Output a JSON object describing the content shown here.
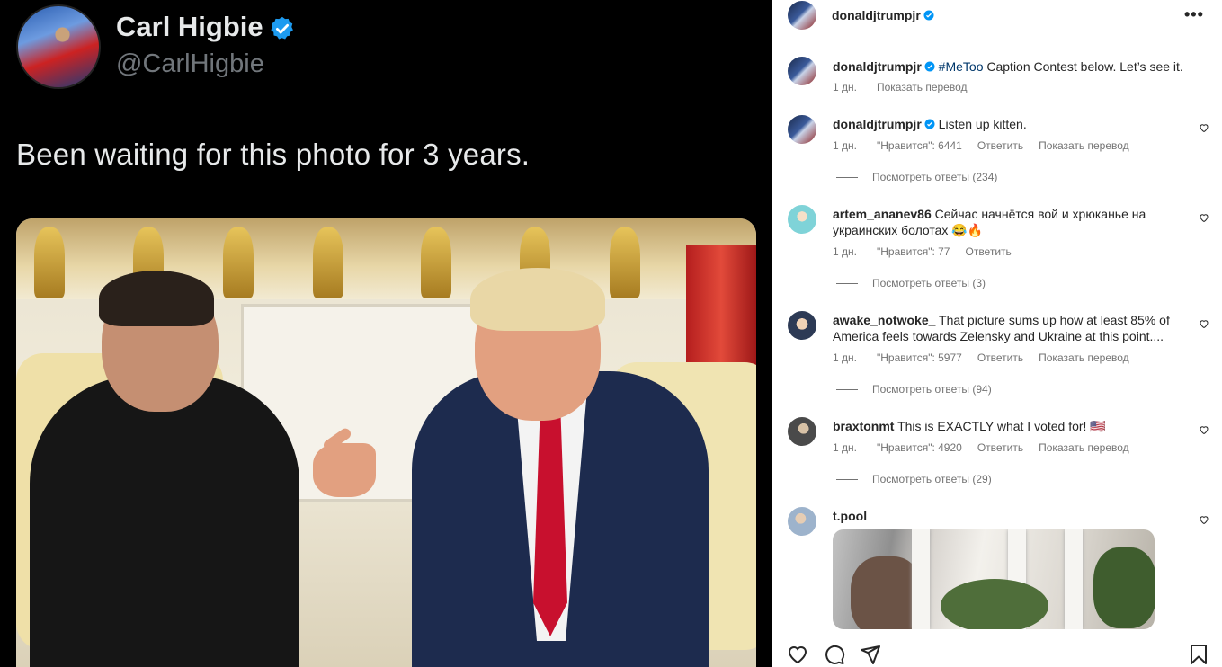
{
  "tweet": {
    "name": "Carl Higbie",
    "handle": "@CarlHigbie",
    "text": "Been waiting for this photo for 3 years."
  },
  "post": {
    "author": "donaldjtrumpjr",
    "more_label": "•••"
  },
  "comments": [
    {
      "user": "donaldjtrumpjr",
      "verified": true,
      "hashtag": "#MeToo",
      "text": " Caption Contest below. Let’s see it.",
      "time": "1 дн.",
      "translate": "Показать перевод"
    },
    {
      "user": "donaldjtrumpjr",
      "verified": true,
      "text": "Listen up kitten.",
      "time": "1 дн.",
      "likes": "\"Нравится\": 6441",
      "reply": "Ответить",
      "translate": "Показать перевод",
      "view_replies": "Посмотреть ответы (234)"
    },
    {
      "user": "artem_ananev86",
      "text": "Сейчас начнётся вой и хрюканье на украинских болотах 😂🔥",
      "time": "1 дн.",
      "likes": "\"Нравится\": 77",
      "reply": "Ответить",
      "view_replies": "Посмотреть ответы (3)"
    },
    {
      "user": "awake_notwoke_",
      "text": "That picture sums up how at least 85% of America feels towards Zelensky and Ukraine at this point....",
      "time": "1 дн.",
      "likes": "\"Нравится\": 5977",
      "reply": "Ответить",
      "translate": "Показать перевод",
      "view_replies": "Посмотреть ответы (94)"
    },
    {
      "user": "braxtonmt",
      "text": "This is EXACTLY what I voted for! 🇺🇸",
      "time": "1 дн.",
      "likes": "\"Нравится\": 4920",
      "reply": "Ответить",
      "translate": "Показать перевод",
      "view_replies": "Посмотреть ответы (29)"
    },
    {
      "user": "t.pool"
    }
  ],
  "colors": {
    "verified": "#0095f6",
    "highlight": "#e41b23",
    "text": "#262626",
    "meta": "#737373"
  },
  "icons": [
    "verified-icon",
    "heart-icon",
    "comment-icon",
    "share-icon",
    "bookmark-icon",
    "more-icon"
  ]
}
